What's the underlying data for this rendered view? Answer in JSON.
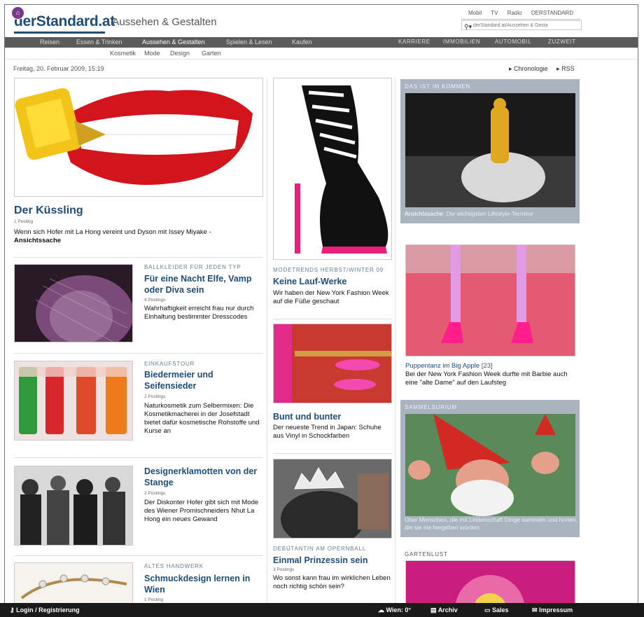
{
  "header": {
    "logo": "derStandard.at",
    "section": "› Aussehen & Gestalten",
    "top_links": [
      "Mobil",
      "TV",
      "Radio",
      "DERSTANDARD"
    ],
    "search_placeholder": "derStandard.at/Aussehen & Gesta"
  },
  "nav": {
    "items": [
      "Reisen",
      "Essen & Trinken",
      "Aussehen & Gestalten",
      "Spielen & Lesen",
      "Kaufen"
    ],
    "right_items": [
      "KARRIERE",
      "IMMOBILIEN",
      "AUTOMOBIL",
      "ZUZWEIT"
    ],
    "sub_items": [
      "Kosmetik",
      "Mode",
      "Design",
      "Garten"
    ]
  },
  "dateline": "Freitag, 20. Februar 2009, 15:19",
  "feeds": [
    "▸ Chronologie",
    "▸ RSS"
  ],
  "lead": {
    "headline": "Der Küssling",
    "postings": "1 Posting",
    "teaser": "Wenn sich Hofer mit La Hong vereint und Dyson mit Issey Miyake -",
    "teaser_link": "Ansichtssache"
  },
  "left_col": [
    {
      "kicker": "BALLKLEIDER FÜR JEDEN TYP",
      "headline": "Für eine Nacht Elfe, Vamp oder Diva sein",
      "postings": "4 Postings",
      "teaser": "Wahrhaftigkeit erreicht frau nur durch Einhaltung bestimmter Dresscodes"
    },
    {
      "kicker": "EINKAUFSTOUR",
      "headline": "Biedermeier und Seifensieder",
      "postings": "2 Postings",
      "teaser": "Naturkosmetik zum Selbermixen: Die Kosmetikmacherei in der Josefstadt bietet dafür kosmetische Rohstoffe und Kurse an"
    },
    {
      "kicker": "",
      "headline": "Designerklamotten von der Stange",
      "postings": "2 Postings",
      "teaser": "Der Diskonter Hofer gibt sich mit Mode des Wiener Promischneiders Nhut La Hong ein neues Gewand"
    },
    {
      "kicker": "ALTES HANDWERK",
      "headline": "Schmuckdesign lernen in Wien",
      "postings": "1 Posting",
      "teaser": ""
    }
  ],
  "mid_col": [
    {
      "kicker": "MODETRENDS HERBST/WINTER 09",
      "headline": "Keine Lauf-Werke",
      "postings": "",
      "teaser": "Wir haben der New York Fashion Week auf die Füße geschaut"
    },
    {
      "kicker": "",
      "headline": "Bunt und bunter",
      "postings": "",
      "teaser": "Der neueste Trend in Japan: Schuhe aus Vinyl in Schockfarben"
    },
    {
      "kicker": "DEBÜTANTIN AM OPERNBALL",
      "headline": "Einmal Prinzessin sein",
      "postings": "3 Postings",
      "teaser": "Wo sonst kann frau im wirklichen Leben noch richtig schön sein?"
    }
  ],
  "right_col": {
    "box1": {
      "label": "DAS IST IM KOMMEN",
      "caption_bold": "Ansichtssache:",
      "caption": " Die wichtigsten Lifestyle-Termine"
    },
    "puppen": {
      "headline": "Puppentanz im Big Apple",
      "count": "[23]",
      "teaser": "Bei der New York Fashion Week durfte mit Barbie auch eine \"alte Dame\" auf den Laufsteg"
    },
    "box2": {
      "label": "SAMMELSURIUM",
      "caption": "Über Menschen, die mit Leidenschaft Dinge sammeln und horten, die sie nie hergeben würden"
    },
    "box3": {
      "label": "GARTENLUST"
    }
  },
  "footer": {
    "login": "Login / Registrierung",
    "weather": "Wien: 0°",
    "archiv": "Archiv",
    "sales": "Sales",
    "impressum": "Impressum"
  },
  "colors": {
    "brand": "#1d4d7a",
    "nav": "#5b5b5b",
    "box": "#a9b4bf",
    "footer": "#1a1a1a"
  }
}
